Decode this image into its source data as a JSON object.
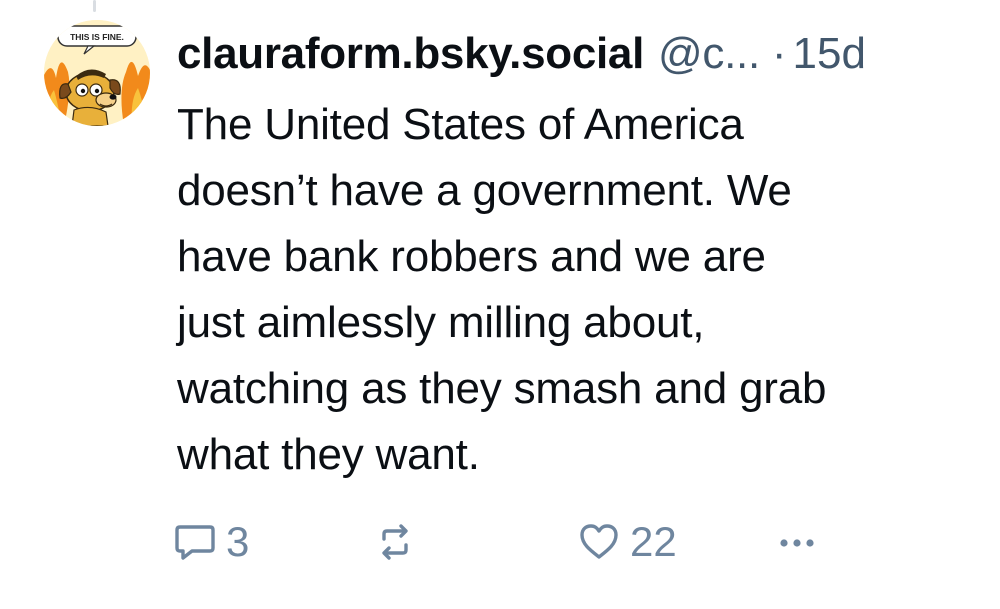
{
  "avatar": {
    "caption": "THIS IS FINE.",
    "icon": "this-is-fine-dog-avatar"
  },
  "post": {
    "display_name": "clauraform.bsky.social",
    "handle": "@c...",
    "separator": "·",
    "age": "15d",
    "text": "The United States of America\ndoesn’t have a government. We\nhave bank robbers and we are\njust aimlessly milling about,\nwatching as they smash and grab\nwhat they want."
  },
  "actions": {
    "reply": {
      "icon": "reply-bubble-icon",
      "count": "3"
    },
    "repost": {
      "icon": "repost-icon",
      "count": ""
    },
    "like": {
      "icon": "heart-icon",
      "count": "22"
    },
    "more": {
      "icon": "more-dots-icon"
    }
  },
  "colors": {
    "text": "#0b0f14",
    "muted": "#42576c",
    "action": "#6f869f",
    "thread_line": "#d9dde2"
  }
}
